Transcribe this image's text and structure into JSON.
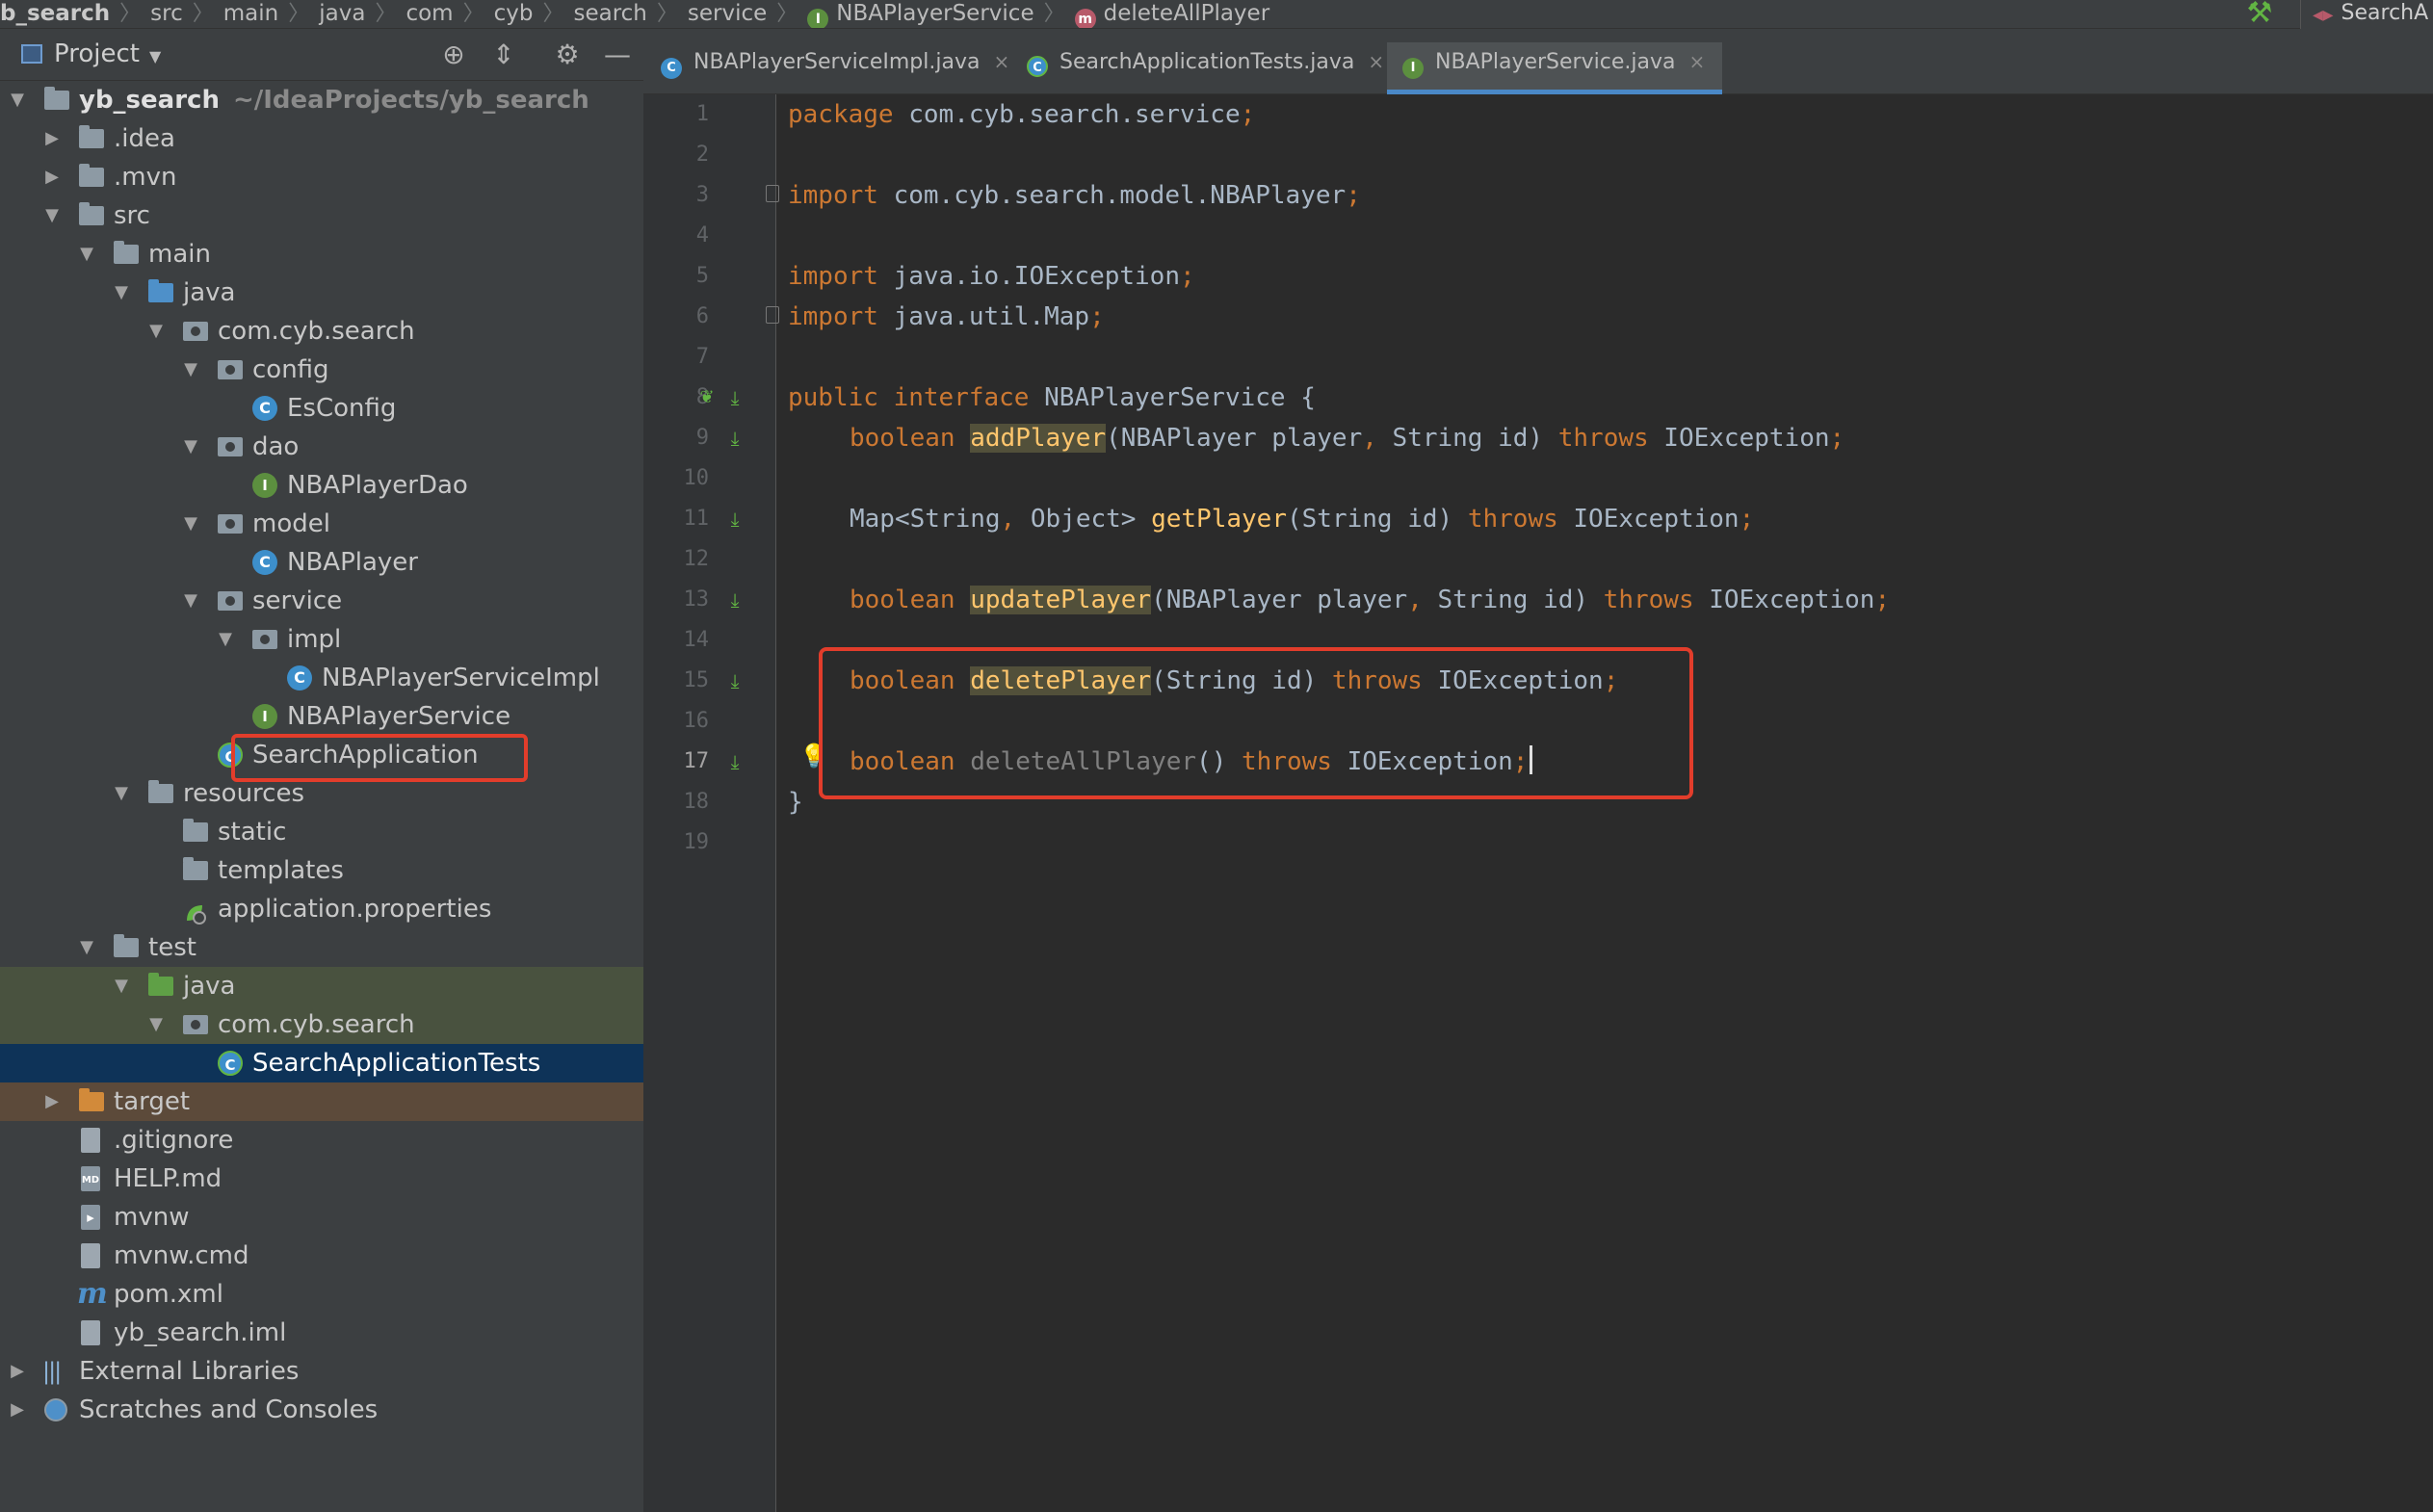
{
  "breadcrumb": {
    "items": [
      "b_search",
      "src",
      "main",
      "java",
      "com",
      "cyb",
      "search",
      "service"
    ],
    "interface_icon": "I",
    "interface_name": "NBAPlayerService",
    "method_icon": "m",
    "method_name": "deleteAllPlayer"
  },
  "run_config": {
    "label": "SearchA",
    "icon": "run-config-icon"
  },
  "project_panel": {
    "title": "Project",
    "tools": [
      "locate-icon",
      "collapse-icon",
      "gear-icon",
      "minimize-icon"
    ]
  },
  "tree": {
    "root_name": "yb_search",
    "root_path": "~/IdeaProjects/yb_search",
    "nodes": [
      ".idea",
      ".mvn",
      "src",
      "main",
      "java",
      "com.cyb.search",
      "config",
      "EsConfig",
      "dao",
      "NBAPlayerDao",
      "model",
      "NBAPlayer",
      "service",
      "impl",
      "NBAPlayerServiceImpl",
      "NBAPlayerService",
      "SearchApplication",
      "resources",
      "static",
      "templates",
      "application.properties",
      "test",
      "java",
      "com.cyb.search",
      "SearchApplicationTests",
      "target",
      ".gitignore",
      "HELP.md",
      "mvnw",
      "mvnw.cmd",
      "pom.xml",
      "yb_search.iml",
      "External Libraries",
      "Scratches and Consoles"
    ],
    "class_badge": "C",
    "interface_badge": "I",
    "md_badge": "MD",
    "term_badge": "▸",
    "maven_badge": "m"
  },
  "tabs": [
    {
      "label": "NBAPlayerServiceImpl.java",
      "icon": "C",
      "close": "×"
    },
    {
      "label": "SearchApplicationTests.java",
      "icon": "C",
      "close": "×"
    },
    {
      "label": "NBAPlayerService.java",
      "icon": "I",
      "close": "×"
    }
  ],
  "editor": {
    "line_numbers": [
      "1",
      "2",
      "3",
      "4",
      "5",
      "6",
      "7",
      "8",
      "9",
      "10",
      "11",
      "12",
      "13",
      "14",
      "15",
      "16",
      "17",
      "18",
      "19"
    ],
    "current_line": "17",
    "tokens": {
      "package": "package",
      "package_name": " com.cyb.search.service",
      "semi": ";",
      "import": "import",
      "import1": " com.cyb.search.model.NBAPlayer",
      "import2": " java.io.IOException",
      "import3": " java.util.Map",
      "public": "public",
      "interface": " interface",
      "iface_name": " NBAPlayerService {",
      "boolean": "boolean",
      "add": "addPlayer",
      "add_args": "(NBAPlayer player",
      "comma": ",",
      "string_id": " String id)",
      "throws": " throws",
      "ioe": " IOException",
      "map_type": "Map<String",
      "object": " Object> ",
      "get": "getPlayer",
      "get_args": "(String id)",
      "update": "updatePlayer",
      "delete": "deletePlayer",
      "delete_all": "deleteAllPlayer",
      "parens": "()",
      "close_brace": "}"
    }
  }
}
